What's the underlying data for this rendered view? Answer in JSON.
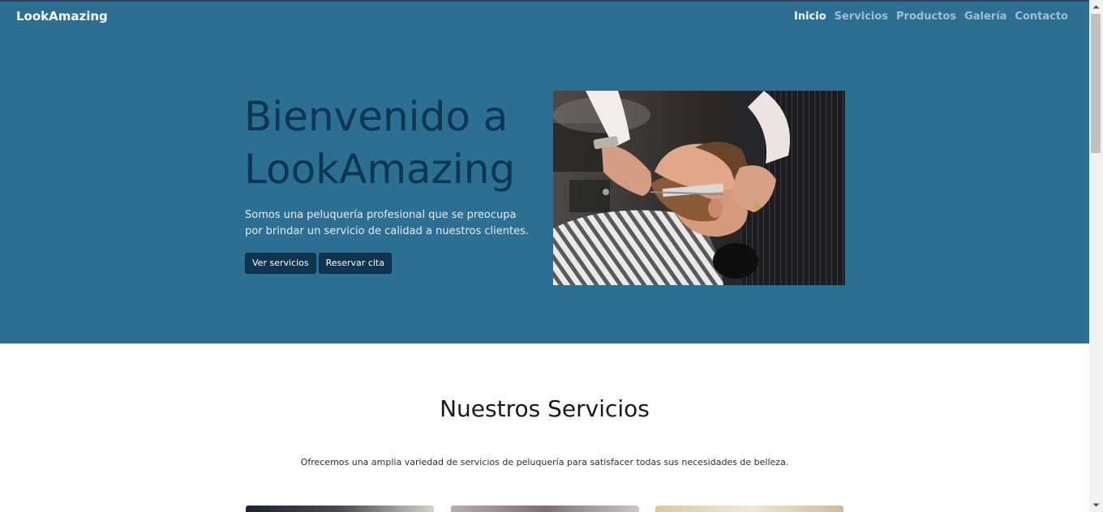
{
  "navbar": {
    "brand": "LookAmazing",
    "links": [
      {
        "label": "Inicio",
        "active": true
      },
      {
        "label": "Servicios",
        "active": false
      },
      {
        "label": "Productos",
        "active": false
      },
      {
        "label": "Galería",
        "active": false
      },
      {
        "label": "Contacto",
        "active": false
      }
    ]
  },
  "hero": {
    "title": "Bienvenido a LookAmazing",
    "text": "Somos una peluquería profesional que se preocupa por brindar un servicio de calidad a nuestros clientes.",
    "buttons": {
      "services_label": "Ver servicios",
      "booking_label": "Reservar cita"
    },
    "image_icon": "barber-trimming-beard-photo"
  },
  "services": {
    "title": "Nuestros Servicios",
    "text": "Ofrecemos una amplia variedad de servicios de peluquería para satisfacer todas sus necesidades de belleza."
  },
  "colors": {
    "hero_background": "#2b6f92",
    "hero_title": "#0f3651",
    "button_background": "#103550",
    "nav_active": "#ffffff",
    "nav_inactive": "#a9bccb"
  }
}
